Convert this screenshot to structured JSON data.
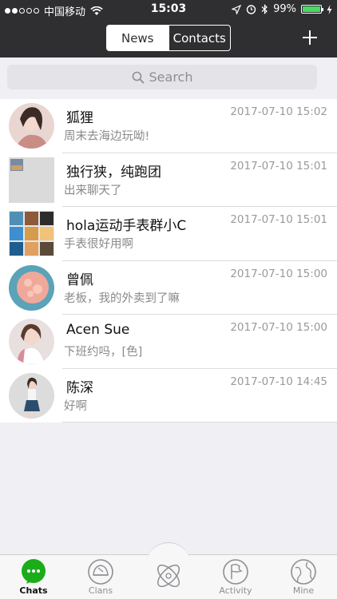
{
  "status_bar": {
    "carrier": "中国移动",
    "time": "15:03",
    "battery_percent": "99%",
    "battery_level": 0.99
  },
  "header": {
    "tabs": [
      {
        "label": "News",
        "active": true
      },
      {
        "label": "Contacts",
        "active": false
      }
    ],
    "add_icon": "plus-icon"
  },
  "search": {
    "placeholder": "Search"
  },
  "chats": [
    {
      "name": "狐狸",
      "message": "周末去海边玩呦!",
      "time": "2017-07-10 15:02"
    },
    {
      "name": "独行狭，纯跑团",
      "message": "出来聊天了",
      "time": "2017-07-10 15:01"
    },
    {
      "name": "hola运动手表群小C",
      "message": "手表很好用啊",
      "time": "2017-07-10 15:01"
    },
    {
      "name": "曾佩",
      "message": "老板，我的外卖到了嘛",
      "time": "2017-07-10 15:00"
    },
    {
      "name": "Acen Sue",
      "message": "下班约吗，[色]",
      "time": "2017-07-10 15:00"
    },
    {
      "name": "陈深",
      "message": "好啊",
      "time": "2017-07-10 14:45"
    }
  ],
  "tabbar": {
    "items": [
      {
        "label": "Chats",
        "icon": "chat-bubble-icon",
        "active": true
      },
      {
        "label": "Clans",
        "icon": "clans-icon",
        "active": false
      },
      {
        "label": "",
        "icon": "center-logo-icon",
        "active": false
      },
      {
        "label": "Activity",
        "icon": "flag-icon",
        "active": false
      },
      {
        "label": "Mine",
        "icon": "globe-icon",
        "active": false
      }
    ]
  },
  "colors": {
    "header_bg": "#2f2f31",
    "accent_green": "#1aad19",
    "battery_green": "#4cd964"
  }
}
